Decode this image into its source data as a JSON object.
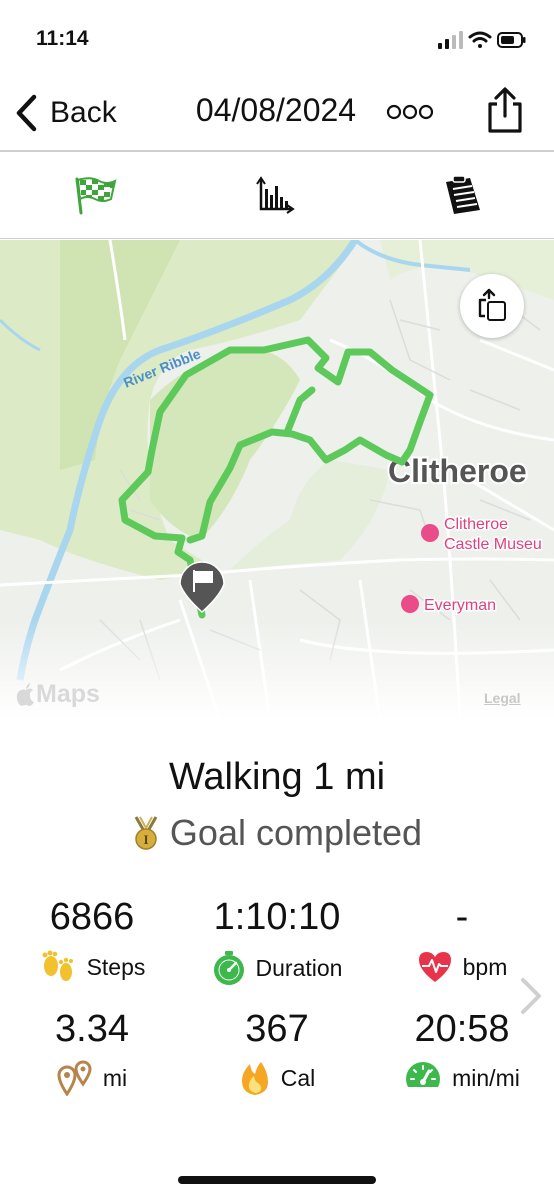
{
  "status_bar": {
    "time": "11:14"
  },
  "nav": {
    "back_label": "Back",
    "title": "04/08/2024"
  },
  "map": {
    "labels": {
      "river": "River Ribble",
      "town": "Clitheroe",
      "poi_1_line1": "Clitheroe",
      "poi_1_line2": "Castle Museu",
      "poi_2": "Everyman"
    },
    "attribution": "Maps",
    "legal": "Legal",
    "route_color": "#5ec95b"
  },
  "summary": {
    "activity": "Walking 1 mi",
    "goal": "Goal completed"
  },
  "stats": [
    {
      "value": "6866",
      "label": "Steps",
      "icon": "footprints-icon"
    },
    {
      "value": "1:10:10",
      "label": "Duration",
      "icon": "stopwatch-icon"
    },
    {
      "value": "-",
      "label": "bpm",
      "icon": "heart-rate-icon"
    },
    {
      "value": "3.34",
      "label": "mi",
      "icon": "location-pins-icon"
    },
    {
      "value": "367",
      "label": "Cal",
      "icon": "flame-icon"
    },
    {
      "value": "20:58",
      "label": "min/mi",
      "icon": "speedometer-icon"
    }
  ]
}
